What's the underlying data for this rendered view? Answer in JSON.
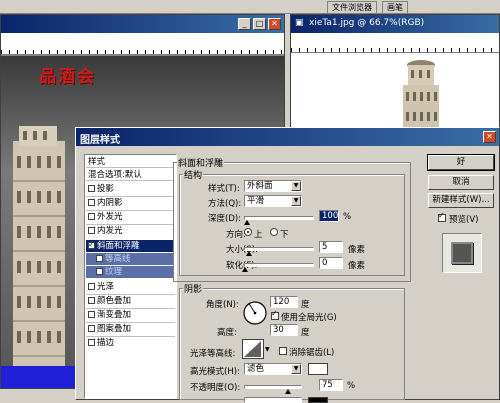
{
  "top_tabs": [
    "文件浏览器",
    "画笔"
  ],
  "left_doc": {
    "overlay_text": "品酒会"
  },
  "right_doc": {
    "title": "xieTa1.jpg @ 66.7%(RGB)"
  },
  "dialog": {
    "title": "图层样式",
    "style_list": {
      "header": "样式",
      "blend_default": "混合选项:默认",
      "items": [
        {
          "label": "投影",
          "checked": false
        },
        {
          "label": "内阴影",
          "checked": false
        },
        {
          "label": "外发光",
          "checked": false
        },
        {
          "label": "内发光",
          "checked": false
        },
        {
          "label": "斜面和浮雕",
          "checked": true
        },
        {
          "label": "等高线",
          "checked": false
        },
        {
          "label": "纹理",
          "checked": false
        },
        {
          "label": "光泽",
          "checked": false
        },
        {
          "label": "颜色叠加",
          "checked": false
        },
        {
          "label": "渐变叠加",
          "checked": false
        },
        {
          "label": "图案叠加",
          "checked": false
        },
        {
          "label": "描边",
          "checked": false
        }
      ]
    },
    "bevel": {
      "section_title": "斜面和浮雕",
      "structure_title": "结构",
      "style_label": "样式(T):",
      "style_value": "外斜面",
      "technique_label": "方法(Q):",
      "technique_value": "平滑",
      "depth_label": "深度(D):",
      "depth_value": "100",
      "depth_unit": "%",
      "direction_label": "方向:",
      "direction_up": "上",
      "direction_down": "下",
      "size_label": "大小(S):",
      "size_value": "5",
      "size_unit": "像素",
      "soften_label": "软化(F):",
      "soften_value": "0",
      "soften_unit": "像素"
    },
    "shading": {
      "title": "阴影",
      "angle_label": "角度(N):",
      "angle_value": "120",
      "angle_unit": "度",
      "global_light_label": "使用全局光(G)",
      "altitude_label": "高度:",
      "altitude_value": "30",
      "altitude_unit": "度",
      "gloss_contour_label": "光泽等高线:",
      "antialias_label": "消除锯齿(L)",
      "highlight_mode_label": "高光模式(H):",
      "highlight_mode_value": "滤色",
      "opacity_label": "不透明度(O):",
      "opacity_value": "75",
      "opacity_unit": "%"
    },
    "buttons": {
      "ok": "好",
      "cancel": "取消",
      "new_style": "新建样式(W)...",
      "preview": "预览(V)"
    }
  }
}
